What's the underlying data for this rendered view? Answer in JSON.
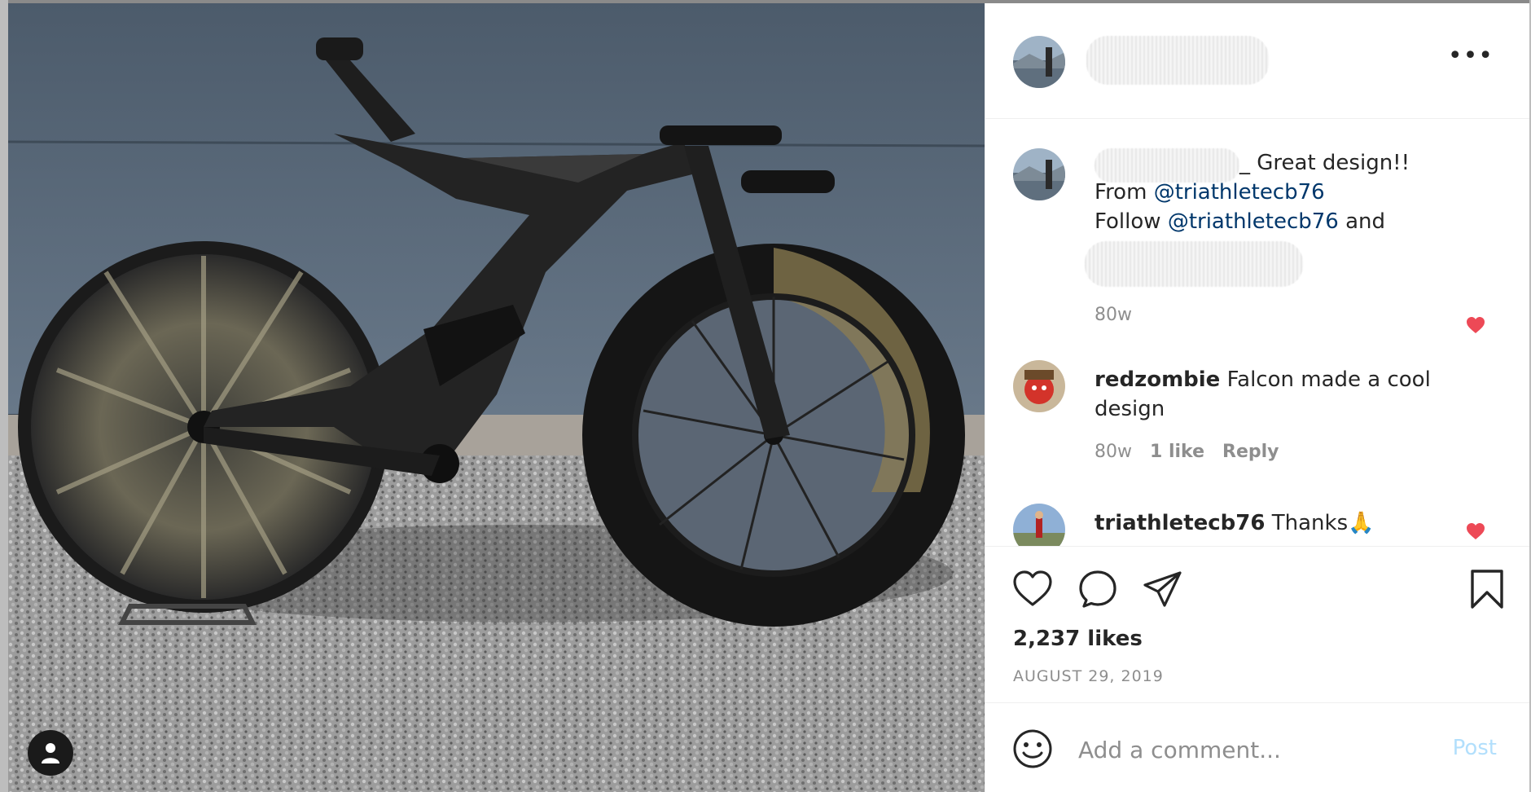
{
  "post": {
    "author_avatar_icon": "user-avatar",
    "more_icon_label": "•••"
  },
  "caption": {
    "text_suffix": "_ Great design!!",
    "line2_prefix": "From ",
    "line2_mention": "@triathletecb76",
    "line3_prefix": "Follow ",
    "line3_mention": "@triathletecb76",
    "line3_suffix": " and",
    "age": "80w"
  },
  "comments": [
    {
      "username": "redzombie",
      "text_line1": "Falcon made a cool",
      "text_line2": "design",
      "age": "80w",
      "likes": "1 like",
      "reply": "Reply"
    },
    {
      "username": "triathletecb76",
      "text": "Thanks🙏"
    }
  ],
  "stats": {
    "likes": "2,237 likes",
    "date": "AUGUST 29, 2019"
  },
  "comment_box": {
    "placeholder": "Add a comment...",
    "post_label": "Post"
  },
  "colors": {
    "heart_red": "#ed4956",
    "link_blue": "#00376b",
    "post_disabled": "#b2dffc",
    "muted_text": "#8e8e8e"
  }
}
